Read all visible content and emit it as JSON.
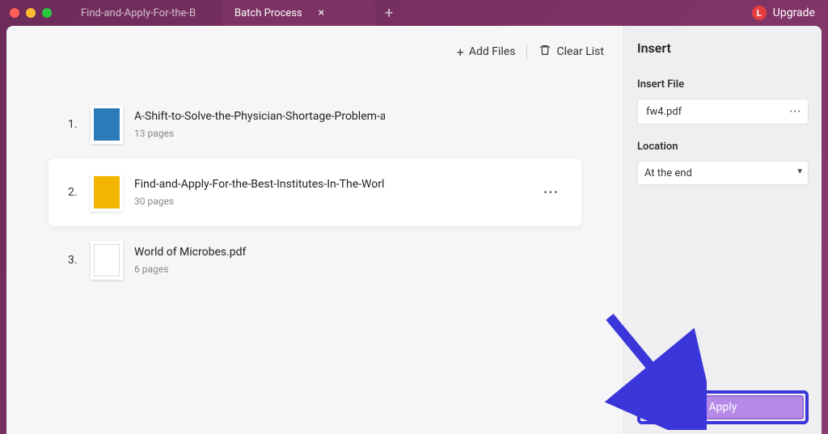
{
  "window": {
    "upgrade_label": "Upgrade",
    "upgrade_avatar": "L"
  },
  "tabs": {
    "items": [
      {
        "label": "Find-and-Apply-For-the-B",
        "active": false
      },
      {
        "label": "Batch Process",
        "active": true
      }
    ]
  },
  "toolbar": {
    "add_files_label": "Add Files",
    "clear_list_label": "Clear List"
  },
  "files": [
    {
      "index": "1.",
      "name": "A-Shift-to-Solve-the-Physician-Shortage-Problem-ar",
      "pages": "13 pages",
      "thumb_color": "#2b7bb9",
      "selected": false
    },
    {
      "index": "2.",
      "name": "Find-and-Apply-For-the-Best-Institutes-In-The-World",
      "pages": "30 pages",
      "thumb_color": "#f2b600",
      "selected": true
    },
    {
      "index": "3.",
      "name": "World of Microbes.pdf",
      "pages": "6 pages",
      "thumb_color": "#ffffff",
      "selected": false
    }
  ],
  "side": {
    "title": "Insert",
    "file_label": "Insert File",
    "file_value": "fw4.pdf",
    "location_label": "Location",
    "location_value": "At the end",
    "apply_label": "Apply"
  }
}
